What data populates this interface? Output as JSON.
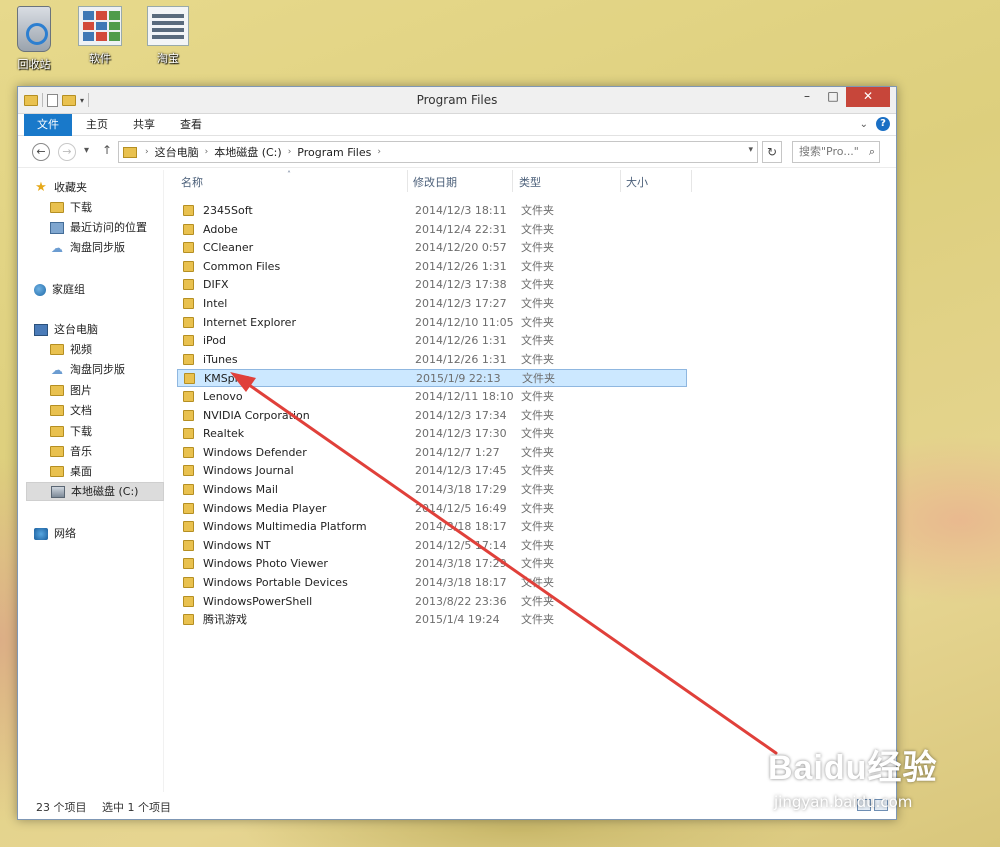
{
  "desktop": {
    "icons": [
      {
        "label": "回收站",
        "icon": "recycle-bin-icon"
      },
      {
        "label": "软件",
        "icon": "thumbnail-grid-icon"
      },
      {
        "label": "淘宝",
        "icon": "list-document-icon"
      }
    ]
  },
  "window": {
    "title": "Program Files",
    "controls": {
      "minimize": "–",
      "maximize": "□",
      "close": "✕"
    }
  },
  "ribbon": {
    "tabs": [
      "文件",
      "主页",
      "共享",
      "查看"
    ],
    "help": "?"
  },
  "address": {
    "crumbs": [
      "这台电脑",
      "本地磁盘 (C:)",
      "Program Files"
    ],
    "search_placeholder": "搜索\"Pro...\""
  },
  "nav": {
    "favorites": "收藏夹",
    "fav_items": [
      "下载",
      "最近访问的位置",
      "淘盘同步版"
    ],
    "homegroup": "家庭组",
    "this_pc": "这台电脑",
    "pc_items": [
      "视频",
      "淘盘同步版",
      "图片",
      "文档",
      "下载",
      "音乐",
      "桌面",
      "本地磁盘 (C:)"
    ],
    "network": "网络"
  },
  "columns": {
    "name": "名称",
    "date": "修改日期",
    "type": "类型",
    "size": "大小"
  },
  "files": [
    {
      "name": "2345Soft",
      "date": "2014/12/3 18:11",
      "type": "文件夹"
    },
    {
      "name": "Adobe",
      "date": "2014/12/4 22:31",
      "type": "文件夹"
    },
    {
      "name": "CCleaner",
      "date": "2014/12/20 0:57",
      "type": "文件夹"
    },
    {
      "name": "Common Files",
      "date": "2014/12/26 1:31",
      "type": "文件夹"
    },
    {
      "name": "DIFX",
      "date": "2014/12/3 17:38",
      "type": "文件夹"
    },
    {
      "name": "Intel",
      "date": "2014/12/3 17:27",
      "type": "文件夹"
    },
    {
      "name": "Internet Explorer",
      "date": "2014/12/10 11:05",
      "type": "文件夹"
    },
    {
      "name": "iPod",
      "date": "2014/12/26 1:31",
      "type": "文件夹"
    },
    {
      "name": "iTunes",
      "date": "2014/12/26 1:31",
      "type": "文件夹"
    },
    {
      "name": "KMSpico",
      "date": "2015/1/9 22:13",
      "type": "文件夹",
      "selected": true
    },
    {
      "name": "Lenovo",
      "date": "2014/12/11 18:10",
      "type": "文件夹"
    },
    {
      "name": "NVIDIA Corporation",
      "date": "2014/12/3 17:34",
      "type": "文件夹"
    },
    {
      "name": "Realtek",
      "date": "2014/12/3 17:30",
      "type": "文件夹"
    },
    {
      "name": "Windows Defender",
      "date": "2014/12/7 1:27",
      "type": "文件夹"
    },
    {
      "name": "Windows Journal",
      "date": "2014/12/3 17:45",
      "type": "文件夹"
    },
    {
      "name": "Windows Mail",
      "date": "2014/3/18 17:29",
      "type": "文件夹"
    },
    {
      "name": "Windows Media Player",
      "date": "2014/12/5 16:49",
      "type": "文件夹"
    },
    {
      "name": "Windows Multimedia Platform",
      "date": "2014/3/18 18:17",
      "type": "文件夹"
    },
    {
      "name": "Windows NT",
      "date": "2014/12/5 17:14",
      "type": "文件夹"
    },
    {
      "name": "Windows Photo Viewer",
      "date": "2014/3/18 17:29",
      "type": "文件夹"
    },
    {
      "name": "Windows Portable Devices",
      "date": "2014/3/18 18:17",
      "type": "文件夹"
    },
    {
      "name": "WindowsPowerShell",
      "date": "2013/8/22 23:36",
      "type": "文件夹"
    },
    {
      "name": "腾讯游戏",
      "date": "2015/1/4 19:24",
      "type": "文件夹"
    }
  ],
  "status": {
    "count": "23 个项目",
    "selected": "选中 1 个项目"
  },
  "watermark": {
    "main": "Baidu经验",
    "sub": "jingyan.baidu.com"
  },
  "annotation": {
    "arrow_color": "#e0403a",
    "highlight_color": "#cce8ff"
  }
}
